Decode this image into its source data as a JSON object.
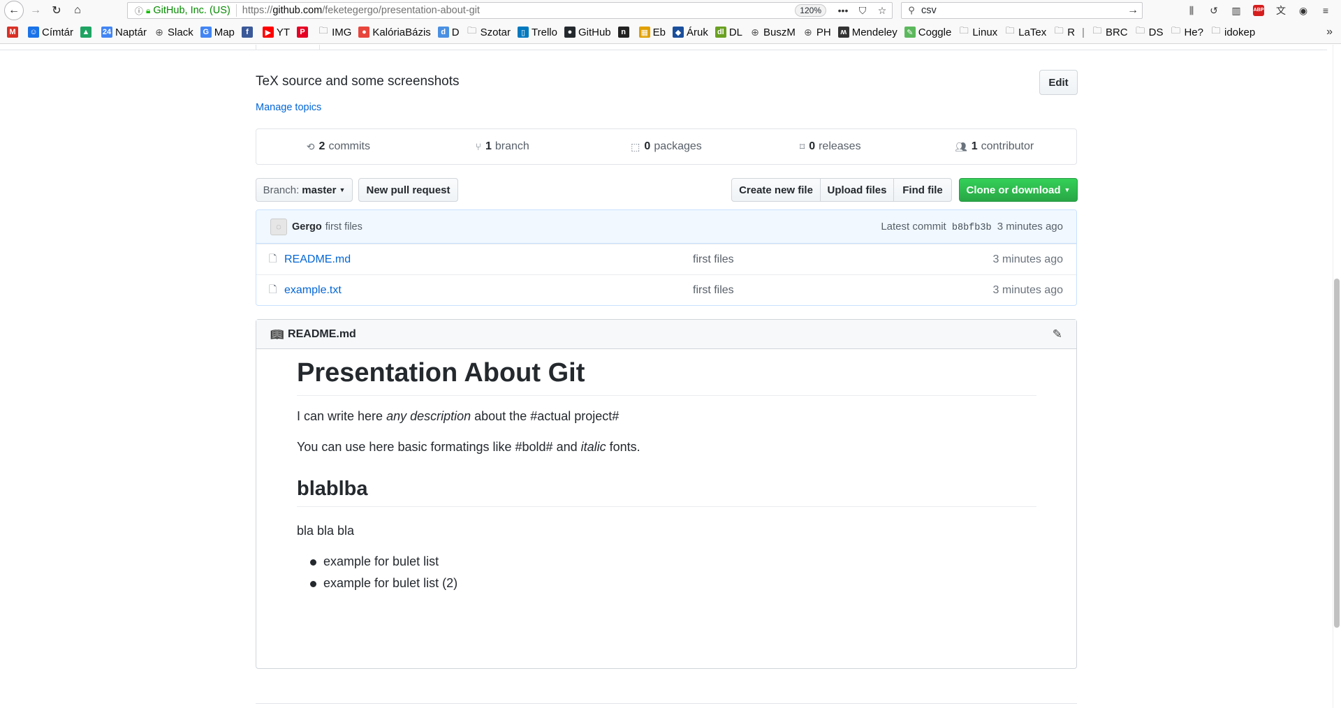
{
  "browser": {
    "url_org": "GitHub, Inc. (US)",
    "url_prefix": "https://",
    "url_host": "github.com",
    "url_path": "/feketegergo/presentation-about-git",
    "zoom": "120%",
    "search_value": "csv"
  },
  "bookmarks": [
    {
      "label": "",
      "icon": "M",
      "color": "#d93025"
    },
    {
      "label": "Címtár",
      "icon": "☺",
      "color": "#1a73e8"
    },
    {
      "label": "",
      "icon": "▲",
      "color": "#1fa463"
    },
    {
      "label": "Naptár",
      "icon": "24",
      "color": "#4285f4"
    },
    {
      "label": "Slack",
      "icon": "globe"
    },
    {
      "label": "Map",
      "icon": "G",
      "color": "#4285f4"
    },
    {
      "label": "",
      "icon": "f",
      "color": "#3b5998"
    },
    {
      "label": "YT",
      "icon": "▶",
      "color": "#ff0000"
    },
    {
      "label": "",
      "icon": "P",
      "color": "#e60023"
    },
    {
      "label": "IMG",
      "icon": "folder"
    },
    {
      "label": "KalóriaBázis",
      "icon": "●",
      "color": "#e8453c"
    },
    {
      "label": "D",
      "icon": "d",
      "color": "#4a90e2"
    },
    {
      "label": "Szotar",
      "icon": "folder"
    },
    {
      "label": "Trello",
      "icon": "▯",
      "color": "#0079bf"
    },
    {
      "label": "GitHub",
      "icon": "●",
      "color": "#24292e"
    },
    {
      "label": "",
      "icon": "n",
      "color": "#222"
    },
    {
      "label": "Eb",
      "icon": "▦",
      "color": "#e0a000"
    },
    {
      "label": "Áruk",
      "icon": "◆",
      "color": "#1a4f9c"
    },
    {
      "label": "DL",
      "icon": "dl",
      "color": "#6aa121"
    },
    {
      "label": "BuszM",
      "icon": "globe"
    },
    {
      "label": "PH",
      "icon": "globe"
    },
    {
      "label": "Mendeley",
      "icon": "ʍ",
      "color": "#333"
    },
    {
      "label": "Coggle",
      "icon": "✎",
      "color": "#5cb85c"
    },
    {
      "label": "Linux",
      "icon": "folder"
    },
    {
      "label": "LaTex",
      "icon": "folder"
    },
    {
      "label": "R",
      "icon": "folder"
    },
    {
      "label": "|",
      "icon": "sep"
    },
    {
      "label": "BRC",
      "icon": "folder"
    },
    {
      "label": "DS",
      "icon": "folder"
    },
    {
      "label": "He?",
      "icon": "folder"
    },
    {
      "label": "idokep",
      "icon": "folder"
    }
  ],
  "repo": {
    "description": "TeX source and some screenshots",
    "edit_label": "Edit",
    "manage_topics": "Manage topics",
    "stats": [
      {
        "count": "2",
        "label": "commits",
        "icon": "history-icon"
      },
      {
        "count": "1",
        "label": "branch",
        "icon": "branch-icon"
      },
      {
        "count": "0",
        "label": "packages",
        "icon": "package-icon"
      },
      {
        "count": "0",
        "label": "releases",
        "icon": "tag-icon"
      },
      {
        "count": "1",
        "label": "contributor",
        "icon": "people-icon"
      }
    ],
    "branch_label": "Branch:",
    "branch_value": "master",
    "new_pr": "New pull request",
    "create_file": "Create new file",
    "upload_files": "Upload files",
    "find_file": "Find file",
    "clone": "Clone or download"
  },
  "commit": {
    "author": "Gergo",
    "message": "first files",
    "latest_label": "Latest commit",
    "sha": "b8bfb3b",
    "age": "3 minutes ago"
  },
  "files": [
    {
      "name": "README.md",
      "message": "first files",
      "age": "3 minutes ago"
    },
    {
      "name": "example.txt",
      "message": "first files",
      "age": "3 minutes ago"
    }
  ],
  "readme": {
    "filename": "README.md",
    "h1": "Presentation About Git",
    "p1_a": "I can write here ",
    "p1_em": "any description",
    "p1_b": " about the #actual project#",
    "p2_a": "You can use here basic formatings like #bold# and ",
    "p2_em": "italic",
    "p2_b": " fonts.",
    "h2": "blablba",
    "p3": "bla bla bla",
    "list": [
      "example for bulet list",
      "example for bulet list (2)"
    ]
  }
}
